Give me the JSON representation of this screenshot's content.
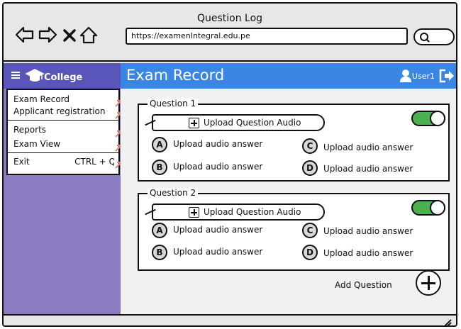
{
  "window": {
    "title": "Question Log",
    "url": "https://examenIntegral.edu.pe"
  },
  "icons": {
    "back": "back-arrow-icon",
    "forward": "forward-arrow-icon",
    "stop": "close-icon",
    "home": "home-icon",
    "search": "search-icon",
    "menu": "hamburger-menu-icon",
    "logo": "graduation-cap-icon",
    "user": "user-icon",
    "logout": "logout-icon",
    "add": "plus-circle-icon",
    "resize": "resize-grip-icon"
  },
  "colors": {
    "sidebar_header": "#5a55b8",
    "sidebar": "#8c7bc1",
    "header_bar": "#3b86e5",
    "toggle_on": "#4caf50"
  },
  "sidebar": {
    "brand": "College",
    "menu": [
      {
        "label": "Exam Record"
      },
      {
        "label": "Applicant registration"
      },
      {
        "label": "Reports"
      },
      {
        "label": "Exam View"
      },
      {
        "label": "Exit",
        "shortcut": "CTRL + Q"
      }
    ]
  },
  "header": {
    "title": "Exam Record",
    "user": "User1"
  },
  "questions": [
    {
      "title": "Question 1",
      "upload_label": "Upload Question Audio",
      "enabled": true,
      "answers": [
        {
          "letter": "A",
          "label": "Upload audio answer"
        },
        {
          "letter": "B",
          "label": "Upload audio answer"
        },
        {
          "letter": "C",
          "label": "Upload audio answer"
        },
        {
          "letter": "D",
          "label": "Upload audio answer"
        }
      ]
    },
    {
      "title": "Question 2",
      "upload_label": "Upload Question Audio",
      "enabled": true,
      "answers": [
        {
          "letter": "A",
          "label": "Upload audio answer"
        },
        {
          "letter": "B",
          "label": "Upload audio answer"
        },
        {
          "letter": "C",
          "label": "Upload audio answer"
        },
        {
          "letter": "D",
          "label": "Upload audio answer"
        }
      ]
    }
  ],
  "add_question_label": "Add Question"
}
